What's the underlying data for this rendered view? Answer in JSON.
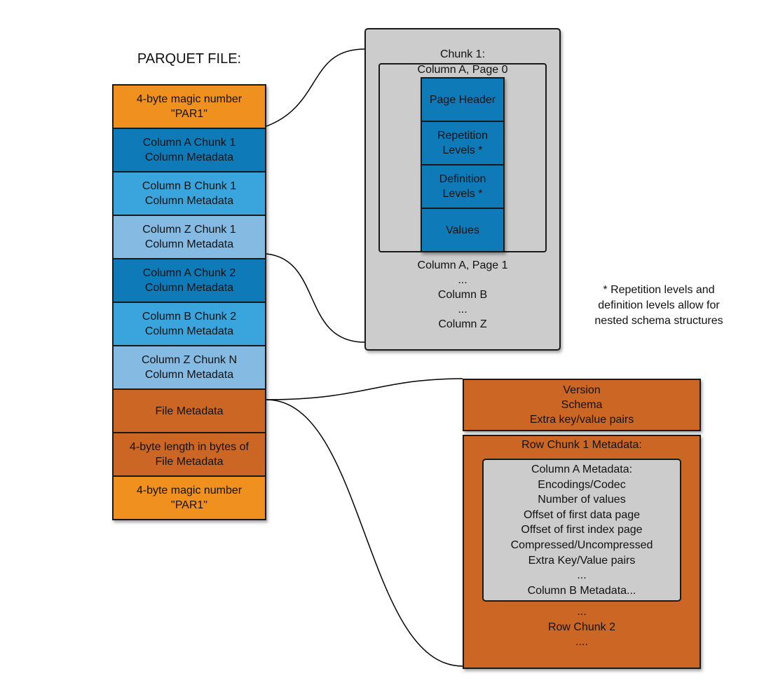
{
  "title": "PARQUET FILE:",
  "colors": {
    "magic": "#F0901E",
    "col_a": "#0E7AB8",
    "col_b": "#3AA4DC",
    "col_z": "#85BBE3",
    "metadata": "#CC6625",
    "gray": "#CCCCCC"
  },
  "file_blocks": [
    {
      "line1": "4-byte magic number",
      "line2": "\"PAR1\"",
      "kind": "magic"
    },
    {
      "line1": "Column A Chunk 1",
      "line2": "Column Metadata",
      "kind": "col_a"
    },
    {
      "line1": "Column B Chunk 1",
      "line2": "Column Metadata",
      "kind": "col_b"
    },
    {
      "line1": "Column Z Chunk 1",
      "line2": "Column Metadata",
      "kind": "col_z"
    },
    {
      "line1": "Column A Chunk 2",
      "line2": "Column Metadata",
      "kind": "col_a"
    },
    {
      "line1": "Column B Chunk 2",
      "line2": "Column Metadata",
      "kind": "col_b"
    },
    {
      "line1": "Column Z Chunk N",
      "line2": "Column Metadata",
      "kind": "col_z"
    },
    {
      "line1": "File Metadata",
      "line2": "",
      "kind": "metadata"
    },
    {
      "line1": "4-byte length in bytes of",
      "line2": "File Metadata",
      "kind": "metadata"
    },
    {
      "line1": "4-byte magic number",
      "line2": "\"PAR1\"",
      "kind": "magic"
    }
  ],
  "chunk": {
    "title": "Chunk 1:",
    "page0_label": "Column A, Page 0",
    "page_parts": [
      {
        "line1": "Page Header",
        "line2": ""
      },
      {
        "line1": "Repetition",
        "line2": "Levels *"
      },
      {
        "line1": "Definition",
        "line2": "Levels *"
      },
      {
        "line1": "Values",
        "line2": ""
      }
    ],
    "after": [
      "Column A, Page 1",
      "...",
      "Column B",
      "...",
      "Column Z"
    ]
  },
  "note": [
    "* Repetition levels and",
    "definition levels allow for",
    "nested schema structures"
  ],
  "file_metadata": {
    "header": [
      "Version",
      "Schema",
      "Extra key/value pairs"
    ],
    "row_chunk_title": "Row Chunk 1 Metadata:",
    "column_metadata": [
      "Column A Metadata:",
      "Encodings/Codec",
      "Number of values",
      "Offset of first data page",
      "Offset of first index page",
      "Compressed/Uncompressed",
      "Extra Key/Value pairs",
      "...",
      "Column B Metadata..."
    ],
    "after": [
      "...",
      "Row Chunk 2",
      "...."
    ]
  }
}
